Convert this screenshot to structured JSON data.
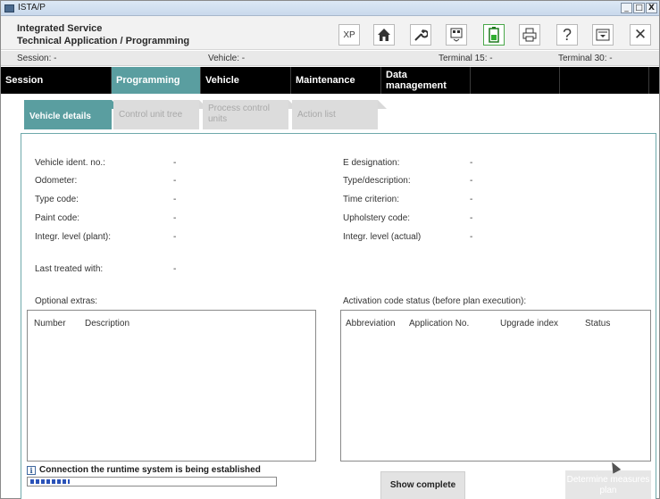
{
  "window": {
    "title": "ISTA/P",
    "min": "_",
    "max": "□",
    "close": "X"
  },
  "header": {
    "brand_line1": "Integrated Service",
    "brand_line2": "Technical Application / Programming",
    "tools": {
      "xp": "XP",
      "home": "⌂",
      "wrench": "🔧",
      "ecu": "▣",
      "battery": "▮",
      "print": "⎙",
      "help": "?",
      "dropdown": "▾",
      "close": "✕"
    }
  },
  "status": {
    "session": "Session:  -",
    "vehicle": "Vehicle:  -",
    "terminal15": "Terminal 15:  -",
    "terminal30": "Terminal 30:  -"
  },
  "nav": {
    "session": "Session",
    "programming": "Programming",
    "vehicle": "Vehicle",
    "maintenance": "Maintenance",
    "data_management": "Data management"
  },
  "tabs": {
    "vehicle_details": "Vehicle details",
    "control_unit_tree": "Control unit tree",
    "process_control_units": "Process control units",
    "action_list": "Action list"
  },
  "details_left": [
    {
      "label": "Vehicle ident. no.:",
      "value": "-"
    },
    {
      "label": "Odometer:",
      "value": "-"
    },
    {
      "label": "Type code:",
      "value": "-"
    },
    {
      "label": "Paint code:",
      "value": "-"
    },
    {
      "label": "Integr. level (plant):",
      "value": "-"
    }
  ],
  "details_right": [
    {
      "label": "E designation:",
      "value": "-"
    },
    {
      "label": "Type/description:",
      "value": "-"
    },
    {
      "label": "Time criterion:",
      "value": "-"
    },
    {
      "label": "Upholstery code:",
      "value": "-"
    },
    {
      "label": "Integr. level (actual)",
      "value": "-"
    }
  ],
  "last_treated": {
    "label": "Last treated with:",
    "value": "-"
  },
  "optional_extras": {
    "title": "Optional extras:",
    "columns": [
      "Number",
      "Description"
    ]
  },
  "activation": {
    "title": "Activation code status (before plan execution):",
    "columns": [
      "Abbreviation",
      "Application No.",
      "Upgrade index",
      "Status"
    ]
  },
  "footer": {
    "info_icon": "i",
    "connection_text": "Connection the runtime system is being established",
    "progress": 0.16,
    "show_complete": "Show complete",
    "determine": "Determine measures plan"
  }
}
